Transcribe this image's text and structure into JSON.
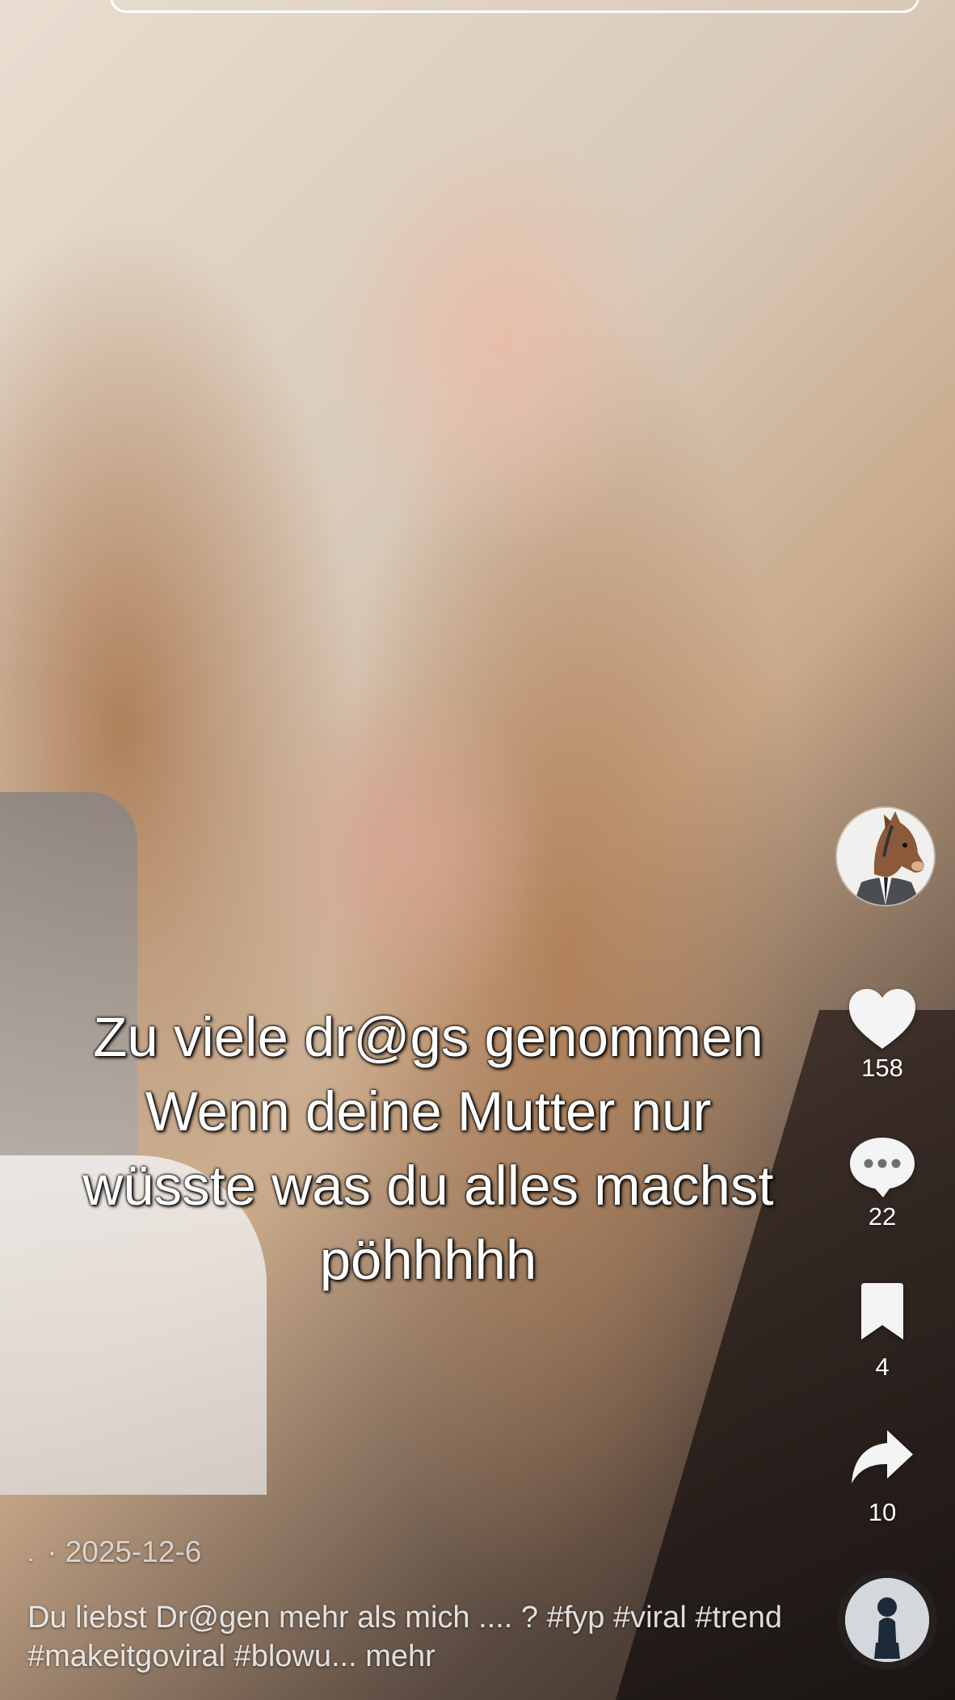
{
  "video": {
    "caption_lines": [
      "Zu viele dr@gs genommen",
      "Wenn deine Mutter nur",
      "wüsste was du alles machst",
      "pöhhhhh"
    ]
  },
  "rail": {
    "creator_avatar": "horse-cartoon-avatar",
    "like": {
      "icon": "heart-icon",
      "count": "158"
    },
    "comment": {
      "icon": "comment-bubble-icon",
      "count": "22"
    },
    "bookmark": {
      "icon": "bookmark-icon",
      "count": "4"
    },
    "share": {
      "icon": "share-arrow-icon",
      "count": "10"
    },
    "music": {
      "icon": "music-disc-avatar"
    }
  },
  "post": {
    "username": ".",
    "date": "· 2025-12-6",
    "description": "Du liebst Dr@gen mehr als mich .... ? #fyp #viral #trend #makeitgoviral #blowu...",
    "more_label": "mehr"
  },
  "colors": {
    "icon": "#ffffff",
    "meta_text": "rgba(255,255,255,0.72)"
  }
}
